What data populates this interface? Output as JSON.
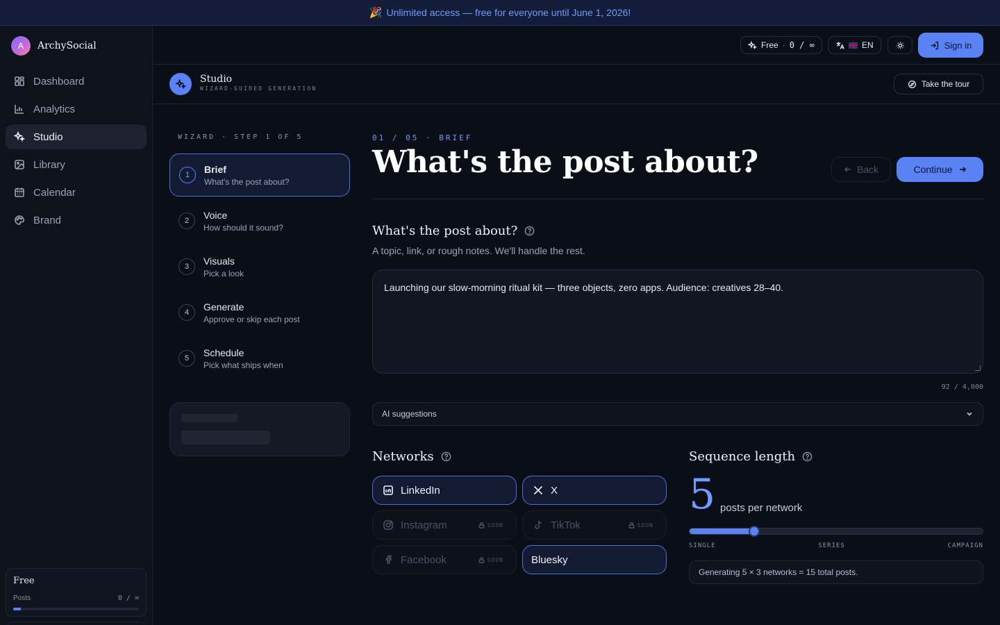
{
  "banner": {
    "emoji": "🎉",
    "text": "Unlimited access — free for everyone until June 1, 2026!"
  },
  "brand": {
    "initial": "A",
    "name": "ArchySocial"
  },
  "nav": [
    {
      "label": "Dashboard",
      "icon": "dashboard-icon"
    },
    {
      "label": "Analytics",
      "icon": "analytics-icon"
    },
    {
      "label": "Studio",
      "icon": "sparkles-icon",
      "active": true
    },
    {
      "label": "Library",
      "icon": "image-icon"
    },
    {
      "label": "Calendar",
      "icon": "calendar-icon"
    },
    {
      "label": "Brand",
      "icon": "palette-icon"
    }
  ],
  "plan": {
    "name": "Free",
    "label": "Posts",
    "usage": "0 / ∞",
    "usage_fraction": 0.06
  },
  "topbar": {
    "plan_label": "Free",
    "plan_sep": "·",
    "plan_usage": "0 / ∞",
    "lang": "EN",
    "signin": "Sign in"
  },
  "studio": {
    "title": "Studio",
    "subtitle": "WIZARD-GUIDED GENERATION",
    "tour": "Take the tour"
  },
  "wizard": {
    "label": "WIZARD · STEP 1 OF 5",
    "steps": [
      {
        "num": "1",
        "title": "Brief",
        "desc": "What's the post about?",
        "active": true
      },
      {
        "num": "2",
        "title": "Voice",
        "desc": "How should it sound?"
      },
      {
        "num": "3",
        "title": "Visuals",
        "desc": "Pick a look"
      },
      {
        "num": "4",
        "title": "Generate",
        "desc": "Approve or skip each post"
      },
      {
        "num": "5",
        "title": "Schedule",
        "desc": "Pick what ships when"
      }
    ]
  },
  "main": {
    "crumb": "01 / 05 · BRIEF",
    "heading": "What's the post about?",
    "back": "Back",
    "continue": "Continue",
    "brief_title": "What's the post about?",
    "brief_sub": "A topic, link, or rough notes. We'll handle the rest.",
    "brief_value": "Launching our slow-morning ritual kit — three objects, zero apps. Audience: creatives 28–40.",
    "counter": "92 / 4,000",
    "ai_suggestions": "AI suggestions"
  },
  "networks": {
    "title": "Networks",
    "soon": "SOON",
    "items": [
      {
        "name": "LinkedIn",
        "icon": "linkedin-icon",
        "selected": true
      },
      {
        "name": "X",
        "icon": "x-icon",
        "selected": true
      },
      {
        "name": "Instagram",
        "icon": "instagram-icon",
        "soon": true
      },
      {
        "name": "TikTok",
        "icon": "tiktok-icon",
        "soon": true
      },
      {
        "name": "Facebook",
        "icon": "facebook-icon",
        "soon": true
      },
      {
        "name": "Bluesky",
        "selected": true
      }
    ]
  },
  "sequence": {
    "title": "Sequence length",
    "value": "5",
    "unit": "posts per network",
    "slider_fraction": 0.22,
    "ticks": [
      "SINGLE",
      "SERIES",
      "CAMPAIGN"
    ],
    "note": "Generating 5 × 3 networks = 15 total posts."
  },
  "colors": {
    "accent": "#5b82f5",
    "accent_text": "#6f9bff",
    "background": "#0a0e17",
    "sidebar": "#0e121b"
  }
}
